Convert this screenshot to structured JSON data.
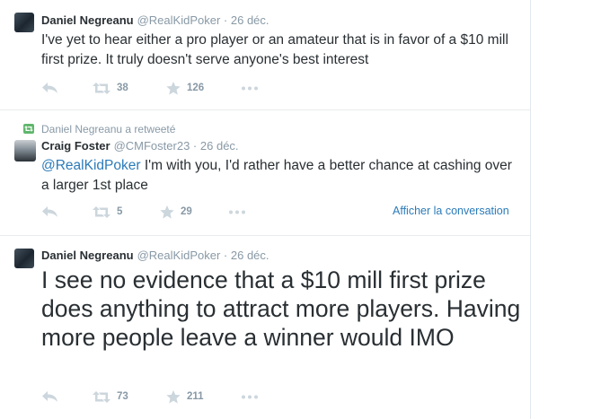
{
  "tweets": [
    {
      "name": "Daniel Negreanu",
      "handle": "@RealKidPoker",
      "separator": "·",
      "time": "26 déc.",
      "text": "I've yet to hear either a pro player or an amateur that is in favor of a $10 mill first prize. It truly doesn't serve anyone's best interest",
      "retweets": "38",
      "favorites": "126"
    },
    {
      "retweeted_by": "Daniel Negreanu a retweeté",
      "name": "Craig Foster",
      "handle": "@CMFoster23",
      "separator": "·",
      "time": "26 déc.",
      "mention": "@RealKidPoker",
      "text": " I'm with you, I'd rather have a better chance at cashing over a larger 1st place",
      "retweets": "5",
      "favorites": "29",
      "view_conversation": "Afficher la conversation"
    },
    {
      "name": "Daniel Negreanu",
      "handle": "@RealKidPoker",
      "separator": "·",
      "time": "26 déc.",
      "text": "I see no evidence that a $10 mill first prize does anything to attract more players. Having more people leave a winner would IMO",
      "retweets": "73",
      "favorites": "211"
    }
  ],
  "colors": {
    "text": "#292f33",
    "muted": "#8899a6",
    "link": "#2b7bb9",
    "retweet_green": "#5fb66c",
    "icon": "#ccd6dd"
  },
  "icons": [
    "reply-icon",
    "retweet-icon",
    "favorite-star-icon",
    "more-icon"
  ]
}
